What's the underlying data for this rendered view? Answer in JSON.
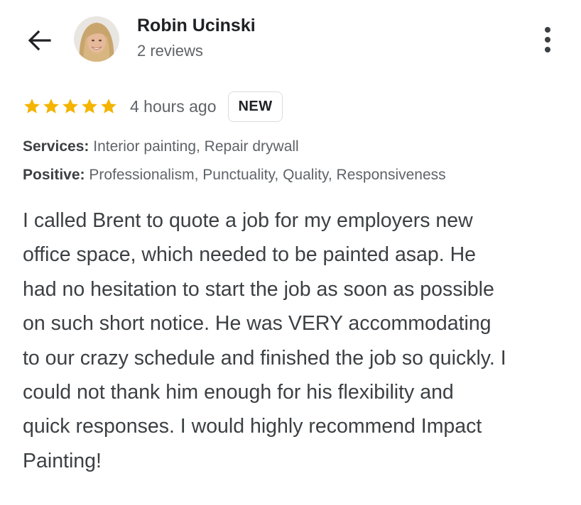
{
  "header": {
    "back_icon": "arrow-back-icon",
    "more_icon": "more-vert-icon",
    "user_name": "Robin Ucinski",
    "review_count": "2 reviews"
  },
  "rating": {
    "stars": 5,
    "max_stars": 5,
    "star_color": "#f4b400",
    "time": "4 hours ago",
    "badge": "NEW"
  },
  "attributes": {
    "services_label": "Services:",
    "services_value": " Interior painting, Repair drywall",
    "positive_label": "Positive:",
    "positive_value": " Professionalism, Punctuality, Quality, Responsiveness"
  },
  "review": {
    "lines": [
      "I called Brent to quote a job for my employers new",
      "office space, which needed to be painted asap. He",
      "had no hesitation to start the job as soon as possible",
      "on such short notice. He was VERY accommodating",
      "to our crazy schedule and finished the job so quickly. I",
      "could not thank him enough for his flexibility and",
      "quick responses. I would highly recommend Impact",
      "Painting!"
    ]
  }
}
